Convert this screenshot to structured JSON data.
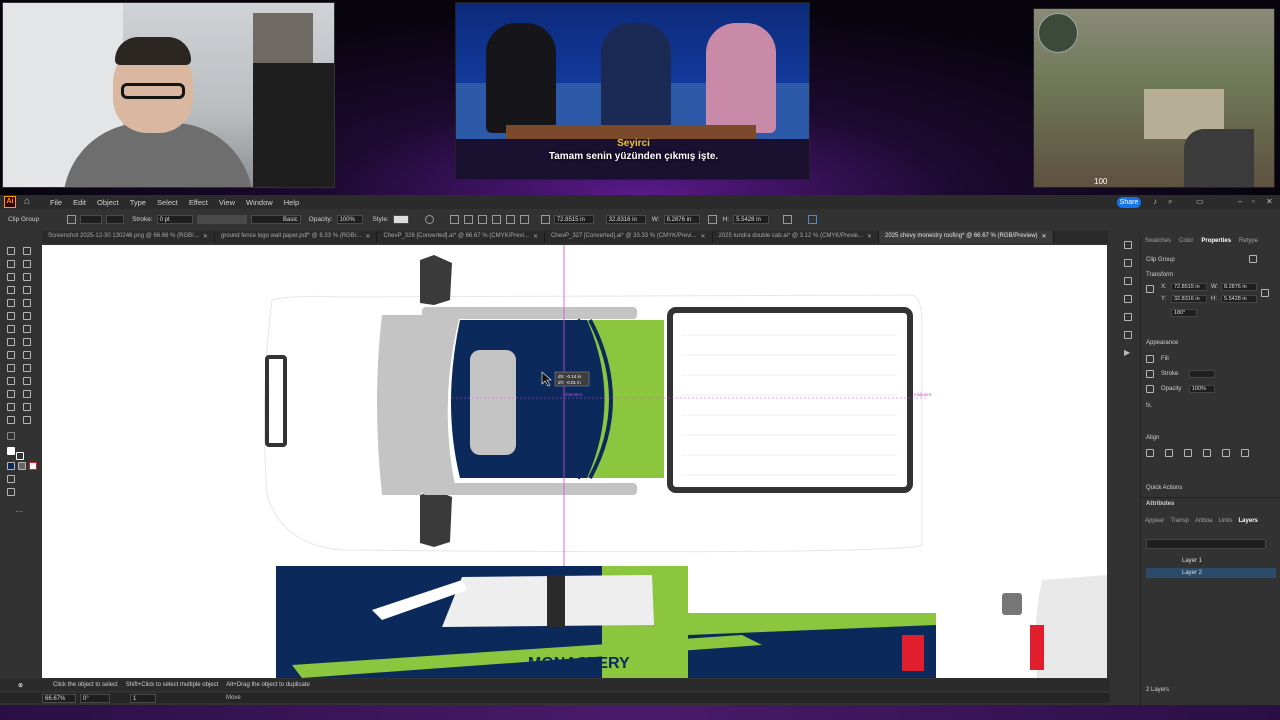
{
  "overlay": {
    "subtitle_speaker": "Seyirci",
    "subtitle_text": "Tamam senin yüzünden çıkmış işte.",
    "game_hp": "100"
  },
  "menubar": {
    "items": [
      "File",
      "Edit",
      "Object",
      "Type",
      "Select",
      "Effect",
      "View",
      "Window",
      "Help"
    ],
    "share_label": "Share"
  },
  "control_bar": {
    "selection_label": "Clip Group",
    "stroke_label": "Stroke:",
    "stroke_value": "0 pt",
    "brush_label": "Basic",
    "opacity_label": "Opacity:",
    "opacity_value": "100%",
    "style_label": "Style:",
    "x_value": "72.8515 in",
    "y_value": "32.8316 in",
    "w_label": "W:",
    "w_value": "8.2876 in",
    "h_label": "H:",
    "h_value": "5.5428 in"
  },
  "doc_tabs": [
    {
      "label": "Screenshot 2025-12-30 130246.png @ 66.66 % (RGB/...",
      "active": false
    },
    {
      "label": "ground fence logo wall paper.pdf* @ 8.33 % (RGB/...",
      "active": false
    },
    {
      "label": "ChevP_326 [Converted].ai* @ 66.67 % (CMYK/Previ...",
      "active": false
    },
    {
      "label": "ChevP_327 [Converted].ai* @ 33.33 % (CMYK/Previ...",
      "active": false
    },
    {
      "label": "2025 tundra double cab.ai* @ 3.12 % (CMYK/Previe...",
      "active": false
    },
    {
      "label": "2025 chevy monestry roofing* @ 66.67 % (RGB/Preview)",
      "active": true
    }
  ],
  "canvas": {
    "tooltip_line1": "dX: -0.14 in",
    "tooltip_line2": "dY: -0.01 in",
    "smart_guide_1": "intersect",
    "smart_guide_2": "midpoint",
    "brand_text": "MONASTERY",
    "colors": {
      "navy": "#0b2a5b",
      "lime": "#8cc63f",
      "gray": "#c4c4c4",
      "dark": "#333333",
      "red": "#e01e2e"
    }
  },
  "hint_bar": {
    "text1": "Click the object to select",
    "text2": "Shift+Click to select multiple object",
    "text3": "Alt+Drag the object to duplicate"
  },
  "status_bar": {
    "zoom": "66.67%",
    "angle": "0°",
    "artboard": "1",
    "mode": "Move"
  },
  "properties_panel": {
    "tabs": [
      "Swatches",
      "Color",
      "Properties",
      "Retype"
    ],
    "active_tab": "Properties",
    "selection": "Clip Group",
    "transform_title": "Transform",
    "x_label": "X:",
    "x_value": "72.8515 in",
    "y_label": "Y:",
    "y_value": "32.8316 in",
    "w_label": "W:",
    "w_value": "8.2876 in",
    "h_label": "H:",
    "h_value": "5.5428 in",
    "angle_value": "180°",
    "appearance_title": "Appearance",
    "fill_label": "Fill",
    "stroke_label": "Stroke",
    "opacity_label": "Opacity",
    "opacity_value": "100%",
    "fx_label": "fx.",
    "align_title": "Align",
    "quick_actions_title": "Quick Actions"
  },
  "layers_panel": {
    "attributes_title": "Attributes",
    "tabs": [
      "Appear",
      "Transp",
      "Artboa",
      "Links",
      "Layers"
    ],
    "active_tab": "Layers",
    "layers": [
      {
        "name": "Layer 1",
        "selected": false
      },
      {
        "name": "Layer 2",
        "selected": true
      }
    ],
    "footer": "2 Layers"
  }
}
